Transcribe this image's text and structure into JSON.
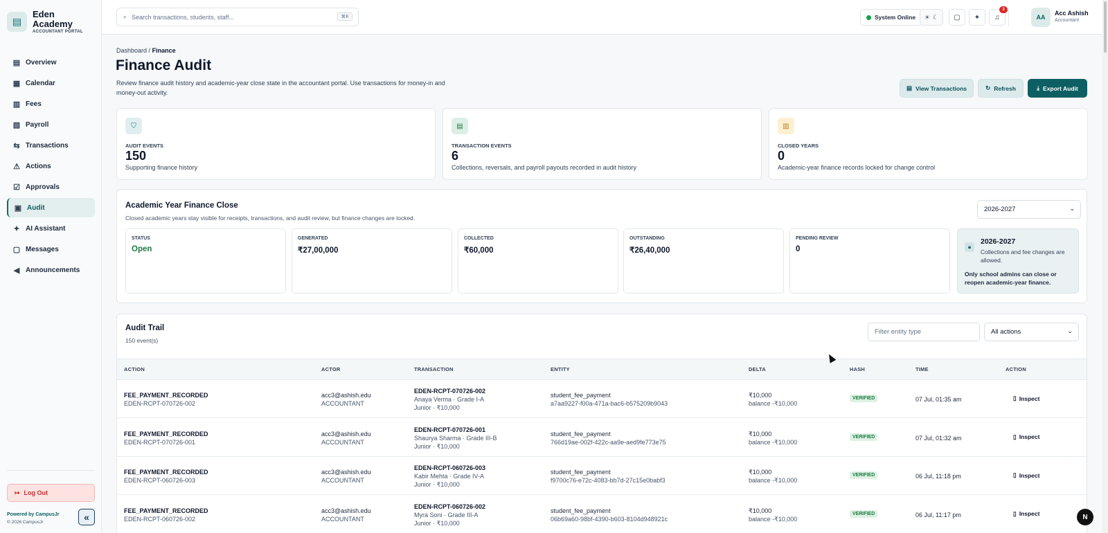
{
  "brand": {
    "name_line1": "Eden",
    "name_line2": "Academy",
    "subtitle": "ACCOUNTANT PORTAL",
    "logo_icon": "school-book-icon"
  },
  "nav": [
    {
      "label": "Overview",
      "icon": "overview-icon",
      "glyph": "▤",
      "active": false
    },
    {
      "label": "Calendar",
      "icon": "calendar-icon",
      "glyph": "▦",
      "active": false
    },
    {
      "label": "Fees",
      "icon": "receipt-icon",
      "glyph": "▥",
      "active": false
    },
    {
      "label": "Payroll",
      "icon": "payroll-icon",
      "glyph": "▧",
      "active": false
    },
    {
      "label": "Transactions",
      "icon": "transfer-icon",
      "glyph": "⇆",
      "active": false
    },
    {
      "label": "Actions",
      "icon": "warning-icon",
      "glyph": "⚠",
      "active": false
    },
    {
      "label": "Approvals",
      "icon": "clipboard-icon",
      "glyph": "☑",
      "active": false
    },
    {
      "label": "Audit",
      "icon": "audit-icon",
      "glyph": "▣",
      "active": true
    },
    {
      "label": "AI Assistant",
      "icon": "sparkle-icon",
      "glyph": "✦",
      "active": false
    },
    {
      "label": "Messages",
      "icon": "message-icon",
      "glyph": "▢",
      "active": false
    },
    {
      "label": "Announcements",
      "icon": "megaphone-icon",
      "glyph": "◀",
      "active": false
    }
  ],
  "sidebar_footer": {
    "logout": "Log Out",
    "powered": "Powered by CampusJr",
    "copyright": "© 2026 CampusJr"
  },
  "topbar": {
    "search_placeholder": "Search transactions, students, staff...",
    "shortcut": "⌘K",
    "system_status": "System Online",
    "notifications_count": "3",
    "user_initials": "AA",
    "user_name": "Acc Ashish",
    "user_role": "Accountant"
  },
  "breadcrumb": {
    "parent": "Dashboard",
    "separator": "/",
    "current": "Finance"
  },
  "page": {
    "title": "Finance Audit",
    "description": "Review finance audit history and academic-year close state in the accountant portal. Use transactions for money-in and money-out activity.",
    "actions": {
      "view_transactions": "View Transactions",
      "refresh": "Refresh",
      "export": "Export Audit"
    }
  },
  "stats": [
    {
      "label": "AUDIT EVENTS",
      "value": "150",
      "desc": "Supporting finance history",
      "icon": "shield-icon",
      "bg": "#e0eef0",
      "fg": "#0e6a6e"
    },
    {
      "label": "TRANSACTION EVENTS",
      "value": "6",
      "desc": "Collections, reversals, and payroll payouts recorded in audit history",
      "icon": "wallet-icon",
      "bg": "#dcefe6",
      "fg": "#1e7a46"
    },
    {
      "label": "CLOSED YEARS",
      "value": "0",
      "desc": "Academic-year finance records locked for change control",
      "icon": "document-icon",
      "bg": "#fdf0d2",
      "fg": "#b7791f"
    }
  ],
  "close": {
    "title": "Academic Year Finance Close",
    "subtitle": "Closed academic years stay visible for receipts, transactions, and audit review, but finance changes are locked.",
    "year_select": "2026-2027",
    "metrics": [
      {
        "label": "STATUS",
        "value": "Open"
      },
      {
        "label": "GENERATED",
        "value": "₹27,00,000"
      },
      {
        "label": "COLLECTED",
        "value": "₹60,000"
      },
      {
        "label": "OUTSTANDING",
        "value": "₹26,40,000"
      },
      {
        "label": "PENDING REVIEW",
        "value": "0"
      }
    ],
    "info": {
      "year": "2026-2027",
      "line": "Collections and fee changes are allowed.",
      "note": "Only school admins can close or reopen academic-year finance."
    }
  },
  "audit": {
    "title": "Audit Trail",
    "count": "150 event(s)",
    "filter_placeholder": "Filter entity type",
    "action_select": "All actions",
    "columns": [
      "ACTION",
      "ACTOR",
      "TRANSACTION",
      "ENTITY",
      "DELTA",
      "HASH",
      "TIME",
      "ACTION"
    ],
    "rows": [
      {
        "action": "FEE_PAYMENT_RECORDED",
        "action_ref": "EDEN-RCPT-070726-002",
        "actor": "acc3@ashish.edu",
        "role": "ACCOUNTANT",
        "txn": "EDEN-RCPT-070726-002",
        "txn_line1": "Anaya Verma · Grade I-A",
        "txn_line2": "Junior · ₹10,000",
        "entity": "student_fee_payment",
        "entity_id": "a7aa9227-f00a-471a-bac6-b575209b9043",
        "delta": "₹10,000",
        "balance": "balance -₹10,000",
        "hash": "VERIFIED",
        "time": "07 Jul, 01:35 am",
        "inspect": "Inspect"
      },
      {
        "action": "FEE_PAYMENT_RECORDED",
        "action_ref": "EDEN-RCPT-070726-001",
        "actor": "acc3@ashish.edu",
        "role": "ACCOUNTANT",
        "txn": "EDEN-RCPT-070726-001",
        "txn_line1": "Shaurya Sharma · Grade III-B",
        "txn_line2": "Junior · ₹10,000",
        "entity": "student_fee_payment",
        "entity_id": "766d19ae-002f-422c-aa9e-aed9fe773e75",
        "delta": "₹10,000",
        "balance": "balance -₹10,000",
        "hash": "VERIFIED",
        "time": "07 Jul, 01:32 am",
        "inspect": "Inspect"
      },
      {
        "action": "FEE_PAYMENT_RECORDED",
        "action_ref": "EDEN-RCPT-060726-003",
        "actor": "acc3@ashish.edu",
        "role": "ACCOUNTANT",
        "txn": "EDEN-RCPT-060726-003",
        "txn_line1": "Kabir Mehta · Grade IV-A",
        "txn_line2": "Junior · ₹10,000",
        "entity": "student_fee_payment",
        "entity_id": "f9700c76-e72c-4083-bb7d-27c15e0babf3",
        "delta": "₹10,000",
        "balance": "balance -₹10,000",
        "hash": "VERIFIED",
        "time": "06 Jul, 11:18 pm",
        "inspect": "Inspect"
      },
      {
        "action": "FEE_PAYMENT_RECORDED",
        "action_ref": "EDEN-RCPT-060726-002",
        "actor": "acc3@ashish.edu",
        "role": "ACCOUNTANT",
        "txn": "EDEN-RCPT-060726-002",
        "txn_line1": "Myra Soni · Grade III-A",
        "txn_line2": "Junior · ₹10,000",
        "entity": "student_fee_payment",
        "entity_id": "06b69a60-98bf-4390-b603-8104d948921c",
        "delta": "₹10,000",
        "balance": "balance -₹10,000",
        "hash": "VERIFIED",
        "time": "06 Jul, 11:17 pm",
        "inspect": "Inspect"
      }
    ]
  },
  "floating_button": "N"
}
